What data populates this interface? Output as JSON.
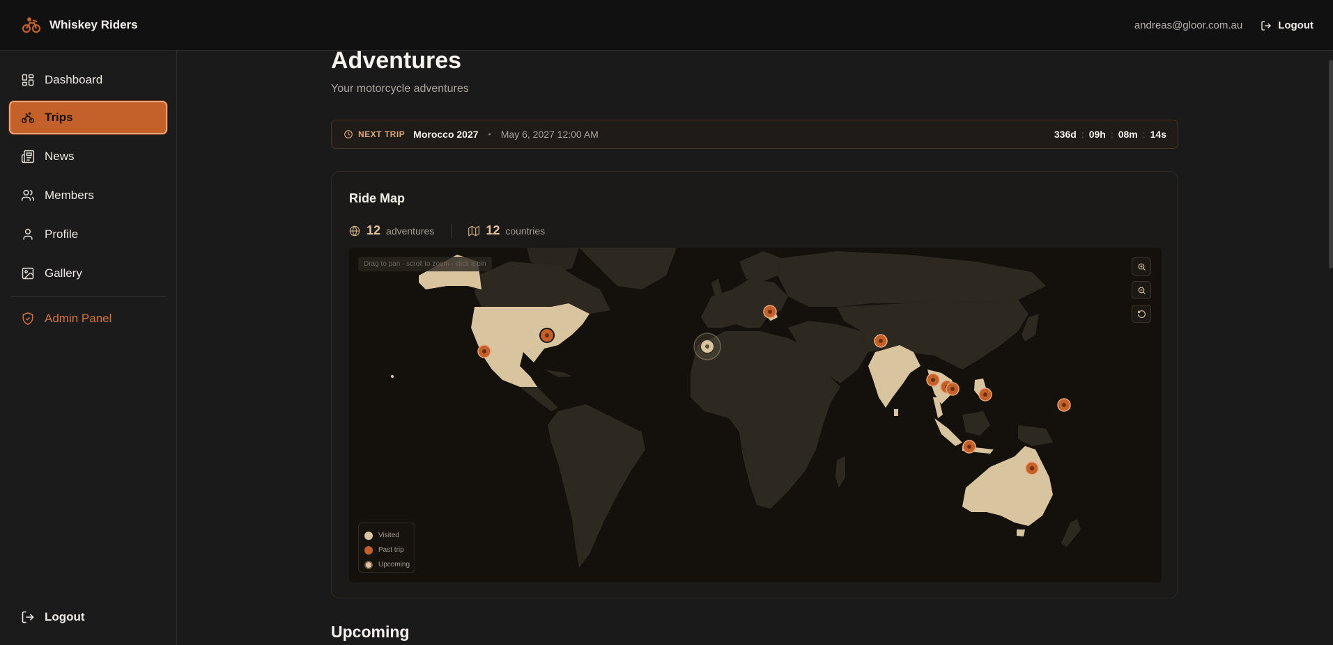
{
  "app": {
    "name": "Whiskey Riders"
  },
  "header": {
    "email": "andreas@gloor.com.au",
    "logout_label": "Logout"
  },
  "sidebar": {
    "items": [
      {
        "label": "Dashboard",
        "icon": "dashboard-icon"
      },
      {
        "label": "Trips",
        "icon": "bike-icon",
        "active": true
      },
      {
        "label": "News",
        "icon": "newspaper-icon"
      },
      {
        "label": "Members",
        "icon": "users-icon"
      },
      {
        "label": "Profile",
        "icon": "user-icon"
      },
      {
        "label": "Gallery",
        "icon": "image-icon"
      }
    ],
    "admin": {
      "label": "Admin Panel",
      "icon": "shield-icon"
    },
    "logout_label": "Logout"
  },
  "page": {
    "title": "Adventures",
    "subtitle": "Your motorcycle adventures"
  },
  "next_trip": {
    "label": "NEXT TRIP",
    "name": "Morocco 2027",
    "separator": "•",
    "date": "May 6, 2027 12:00 AM",
    "countdown": {
      "days": "336d",
      "hours": "09h",
      "minutes": "08m",
      "seconds": "14s"
    }
  },
  "ride_map": {
    "title": "Ride Map",
    "adventures_count": "12",
    "adventures_label": "adventures",
    "countries_count": "12",
    "countries_label": "countries",
    "hint": "Drag to pan · scroll to zoom · click a pin",
    "legend": [
      {
        "label": "Visited",
        "color": "#d9c4a0"
      },
      {
        "label": "Past trip",
        "color": "#c4612a"
      },
      {
        "label": "Upcoming",
        "color": "#d9c4a0"
      }
    ]
  },
  "sections": {
    "upcoming_title": "Upcoming"
  },
  "colors": {
    "accent": "#c4612a",
    "visited": "#d9c4a0",
    "land": "#2d2820",
    "ocean": "#14110d"
  }
}
